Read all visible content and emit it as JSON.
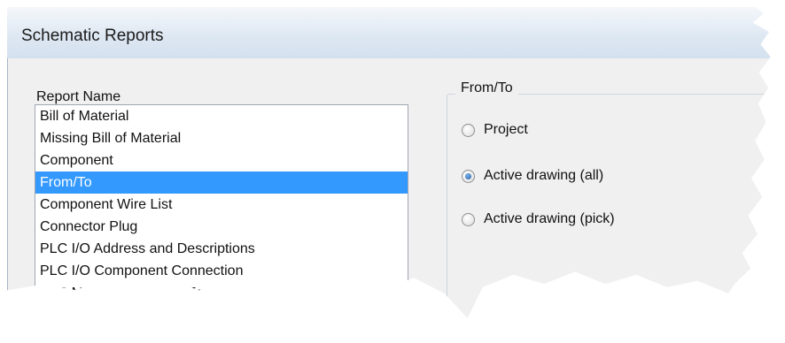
{
  "window": {
    "title": "Schematic Reports"
  },
  "report_list": {
    "label": "Report Name",
    "items": [
      "Bill of Material",
      "Missing Bill of Material",
      "Component",
      "From/To",
      "Component Wire List",
      "Connector Plug",
      "PLC I/O Address and Descriptions",
      "PLC I/O Component Connection",
      "PLC Modules Used So Far"
    ],
    "selected_item": "From/To"
  },
  "from_to": {
    "legend": "From/To",
    "options": [
      {
        "label": "Project",
        "checked": false
      },
      {
        "label": "Active drawing (all)",
        "checked": true
      },
      {
        "label": "Active drawing (pick)",
        "checked": false
      }
    ]
  }
}
